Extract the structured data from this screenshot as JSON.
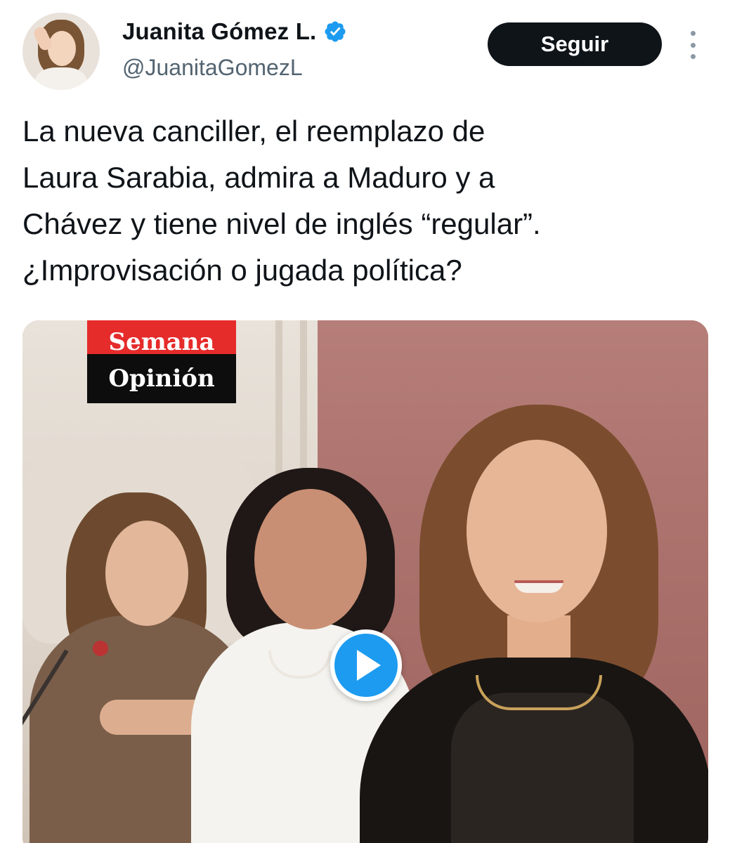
{
  "author": {
    "display_name": "Juanita Gómez L.",
    "handle": "@JuanitaGomezL",
    "verified": true,
    "avatar": "profile-photo"
  },
  "header": {
    "follow_label": "Seguir",
    "more_icon": "more-vertical-icon"
  },
  "tweet": {
    "text": "La nueva canciller, el reemplazo de\nLaura Sarabia, admira a Maduro y a\nChávez y tiene nivel de inglés “regular”.\n¿Improvisación o jugada política?"
  },
  "media": {
    "type": "video",
    "logo_top": "Semana",
    "logo_bottom": "Opinión",
    "play_icon": "play-icon"
  },
  "colors": {
    "follow_bg": "#0f1419",
    "verified": "#1d9bf0",
    "play": "#1d9bf0",
    "semana_red": "#e62b2b"
  }
}
